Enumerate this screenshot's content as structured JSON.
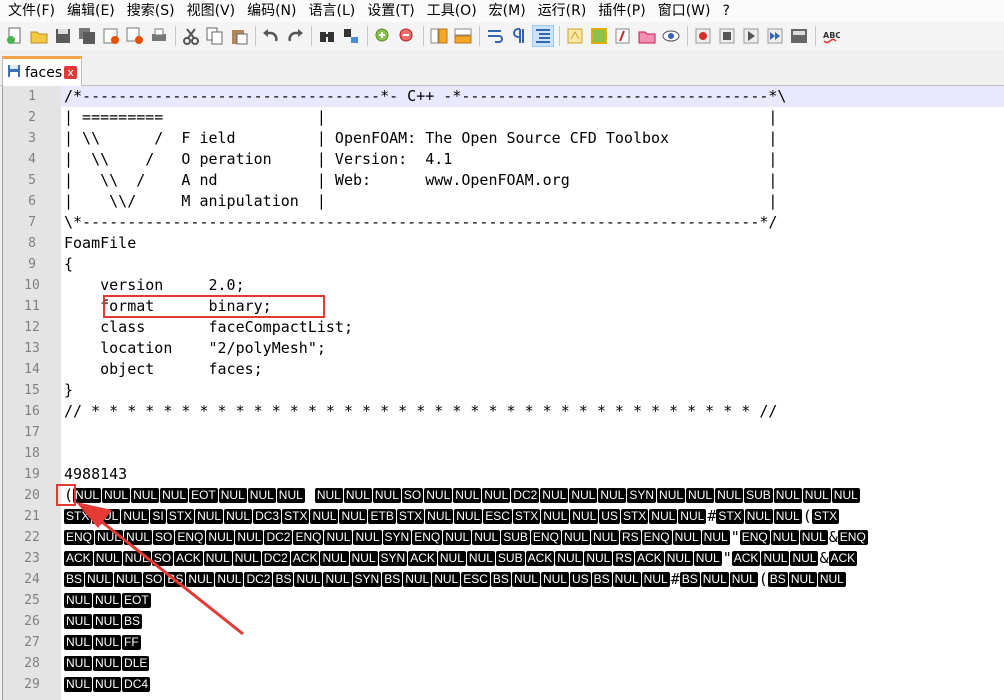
{
  "menu": [
    "文件(F)",
    "编辑(E)",
    "搜索(S)",
    "视图(V)",
    "编码(N)",
    "语言(L)",
    "设置(T)",
    "工具(O)",
    "宏(M)",
    "运行(R)",
    "插件(P)",
    "窗口(W)",
    "?"
  ],
  "tab": {
    "label": "faces",
    "close": "x"
  },
  "line_numbers": [
    "1",
    "2",
    "3",
    "4",
    "5",
    "6",
    "7",
    "8",
    "9",
    "10",
    "11",
    "12",
    "13",
    "14",
    "15",
    "16",
    "17",
    "18",
    "19",
    "20",
    "21",
    "22",
    "23",
    "24",
    "25",
    "26",
    "27",
    "28",
    "29"
  ],
  "code_lines": [
    "/*---------------------------------*- C++ -*----------------------------------*\\",
    "| =========                 |                                                 |",
    "| \\\\      /  F ield         | OpenFOAM: The Open Source CFD Toolbox           |",
    "|  \\\\    /   O peration     | Version:  4.1                                   |",
    "|   \\\\  /    A nd           | Web:      www.OpenFOAM.org                      |",
    "|    \\\\/     M anipulation  |                                                 |",
    "\\*---------------------------------------------------------------------------*/",
    "FoamFile",
    "{",
    "    version     2.0;",
    "    format      binary;",
    "    class       faceCompactList;",
    "    location    \"2/polyMesh\";",
    "    object      faces;",
    "}",
    "// * * * * * * * * * * * * * * * * * * * * * * * * * * * * * * * * * * * * * //",
    "",
    "",
    "4988143"
  ],
  "binary_lines": [
    {
      "prefix": "(",
      "tokens": [
        "NUL",
        "NUL",
        "NUL",
        "NUL",
        "EOT",
        "NUL",
        "NUL",
        "NUL",
        " ",
        "NUL",
        "NUL",
        "NUL",
        "SO",
        "NUL",
        "NUL",
        "NUL",
        "DC2",
        "NUL",
        "NUL",
        "NUL",
        "SYN",
        "NUL",
        "NUL",
        "NUL",
        "SUB",
        "NUL",
        "NUL",
        "NUL"
      ]
    },
    {
      "prefix": "",
      "tokens": [
        "STX",
        "NUL",
        "NUL",
        "SI",
        "STX",
        "NUL",
        "NUL",
        "DC3",
        "STX",
        "NUL",
        "NUL",
        "ETB",
        "STX",
        "NUL",
        "NUL",
        "ESC",
        "STX",
        "NUL",
        "NUL",
        "US",
        "STX",
        "NUL",
        "NUL",
        "#",
        "STX",
        "NUL",
        "NUL",
        "(",
        "STX"
      ]
    },
    {
      "prefix": "",
      "tokens": [
        "ENQ",
        "NUL",
        "NUL",
        "SO",
        "ENQ",
        "NUL",
        "NUL",
        "DC2",
        "ENQ",
        "NUL",
        "NUL",
        "SYN",
        "ENQ",
        "NUL",
        "NUL",
        "SUB",
        "ENQ",
        "NUL",
        "NUL",
        "RS",
        "ENQ",
        "NUL",
        "NUL",
        "\"",
        "ENQ",
        "NUL",
        "NUL",
        "&",
        "ENQ"
      ]
    },
    {
      "prefix": "",
      "tokens": [
        "ACK",
        "NUL",
        "NUL",
        "SO",
        "ACK",
        "NUL",
        "NUL",
        "DC2",
        "ACK",
        "NUL",
        "NUL",
        "SYN",
        "ACK",
        "NUL",
        "NUL",
        "SUB",
        "ACK",
        "NUL",
        "NUL",
        "RS",
        "ACK",
        "NUL",
        "NUL",
        "\"",
        "ACK",
        "NUL",
        "NUL",
        "&",
        "ACK"
      ]
    },
    {
      "prefix": "",
      "tokens": [
        "BS",
        "NUL",
        "NUL",
        "SO",
        "BS",
        "NUL",
        "NUL",
        "DC2",
        "BS",
        "NUL",
        "NUL",
        "SYN",
        "BS",
        "NUL",
        "NUL",
        "ESC",
        "BS",
        "NUL",
        "NUL",
        "US",
        "BS",
        "NUL",
        "NUL",
        "#",
        "BS",
        "NUL",
        "NUL",
        "(",
        "BS",
        "NUL",
        "NUL"
      ]
    },
    {
      "prefix": "",
      "tokens": [
        "NUL",
        "NUL",
        "EOT"
      ]
    },
    {
      "prefix": "",
      "tokens": [
        "NUL",
        "NUL",
        "BS"
      ]
    },
    {
      "prefix": "",
      "tokens": [
        "NUL",
        "NUL",
        "FF"
      ]
    },
    {
      "prefix": "",
      "tokens": [
        "NUL",
        "NUL",
        "DLE"
      ]
    },
    {
      "prefix": "",
      "tokens": [
        "NUL",
        "NUL",
        "DC4"
      ]
    }
  ],
  "toolbar_icons": [
    "new-file-icon",
    "open-file-icon",
    "save-icon",
    "save-all-icon",
    "close-icon",
    "close-all-icon",
    "print-icon",
    "|",
    "cut-icon",
    "copy-icon",
    "paste-icon",
    "|",
    "undo-icon",
    "redo-icon",
    "|",
    "find-icon",
    "replace-icon",
    "|",
    "zoom-in-icon",
    "zoom-out-icon",
    "|",
    "sync-vertical-icon",
    "sync-horizontal-icon",
    "|",
    "word-wrap-icon",
    "show-all-chars-icon",
    "indent-guide-icon",
    "|",
    "udl-icon",
    "doc-map-icon",
    "function-list-icon",
    "folder-workspace-icon",
    "monitor-icon",
    "|",
    "record-macro-icon",
    "stop-record-icon",
    "play-macro-icon",
    "run-macro-multiple-icon",
    "save-macro-icon",
    "|",
    "spell-check-icon"
  ],
  "colors": {
    "accent_tab": "#f7a24b",
    "annotation_red": "#e53935",
    "gutter": "#e4e4e4",
    "caret_line": "#e8e8ff"
  }
}
